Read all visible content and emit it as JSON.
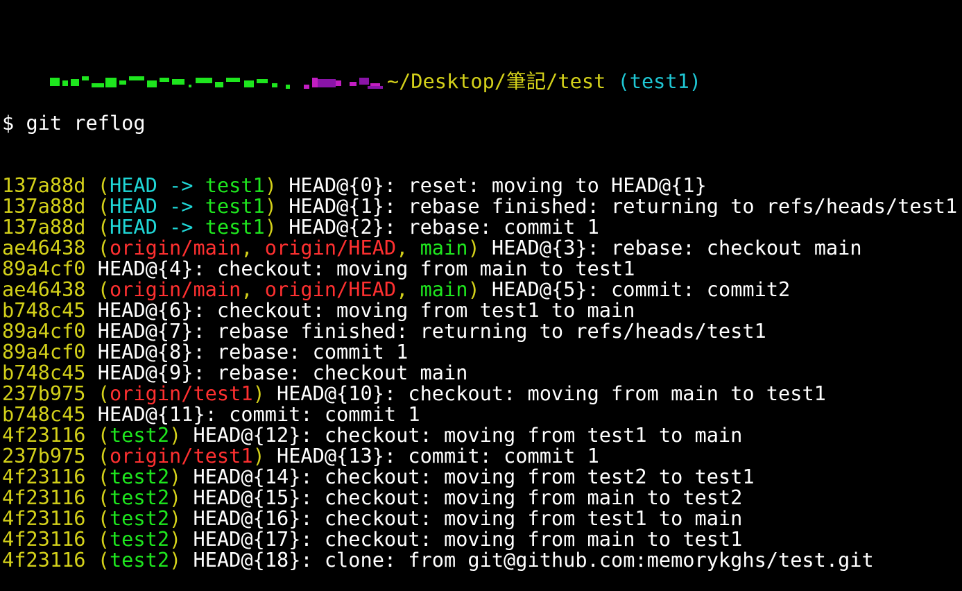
{
  "prompt": {
    "path": "~/Desktop/筆記/test",
    "branch": "(test1)"
  },
  "command": {
    "symbol": "$",
    "text": "git reflog"
  },
  "colors": {
    "hash": "#d4d11a",
    "head": "#1fd7d7",
    "local_branch": "#1ee61e",
    "remote_branch": "#ff3030",
    "text": "#ffffff",
    "background": "#000000"
  },
  "reflog": [
    {
      "hash": "137a88d",
      "refs": [
        {
          "t": "(",
          "c": "yellow"
        },
        {
          "t": "HEAD -> ",
          "c": "cyan"
        },
        {
          "t": "test1",
          "c": "green"
        },
        {
          "t": ")",
          "c": "yellow"
        }
      ],
      "message": "HEAD@{0}: reset: moving to HEAD@{1}"
    },
    {
      "hash": "137a88d",
      "refs": [
        {
          "t": "(",
          "c": "yellow"
        },
        {
          "t": "HEAD -> ",
          "c": "cyan"
        },
        {
          "t": "test1",
          "c": "green"
        },
        {
          "t": ")",
          "c": "yellow"
        }
      ],
      "message": "HEAD@{1}: rebase finished: returning to refs/heads/test1"
    },
    {
      "hash": "137a88d",
      "refs": [
        {
          "t": "(",
          "c": "yellow"
        },
        {
          "t": "HEAD -> ",
          "c": "cyan"
        },
        {
          "t": "test1",
          "c": "green"
        },
        {
          "t": ")",
          "c": "yellow"
        }
      ],
      "message": "HEAD@{2}: rebase: commit 1"
    },
    {
      "hash": "ae46438",
      "refs": [
        {
          "t": "(",
          "c": "yellow"
        },
        {
          "t": "origin/main",
          "c": "red"
        },
        {
          "t": ", ",
          "c": "yellow"
        },
        {
          "t": "origin/HEAD",
          "c": "red"
        },
        {
          "t": ", ",
          "c": "yellow"
        },
        {
          "t": "main",
          "c": "green"
        },
        {
          "t": ")",
          "c": "yellow"
        }
      ],
      "message": "HEAD@{3}: rebase: checkout main"
    },
    {
      "hash": "89a4cf0",
      "refs": [],
      "message": "HEAD@{4}: checkout: moving from main to test1"
    },
    {
      "hash": "ae46438",
      "refs": [
        {
          "t": "(",
          "c": "yellow"
        },
        {
          "t": "origin/main",
          "c": "red"
        },
        {
          "t": ", ",
          "c": "yellow"
        },
        {
          "t": "origin/HEAD",
          "c": "red"
        },
        {
          "t": ", ",
          "c": "yellow"
        },
        {
          "t": "main",
          "c": "green"
        },
        {
          "t": ")",
          "c": "yellow"
        }
      ],
      "message": "HEAD@{5}: commit: commit2"
    },
    {
      "hash": "b748c45",
      "refs": [],
      "message": "HEAD@{6}: checkout: moving from test1 to main"
    },
    {
      "hash": "89a4cf0",
      "refs": [],
      "message": "HEAD@{7}: rebase finished: returning to refs/heads/test1"
    },
    {
      "hash": "89a4cf0",
      "refs": [],
      "message": "HEAD@{8}: rebase: commit 1"
    },
    {
      "hash": "b748c45",
      "refs": [],
      "message": "HEAD@{9}: rebase: checkout main"
    },
    {
      "hash": "237b975",
      "refs": [
        {
          "t": "(",
          "c": "yellow"
        },
        {
          "t": "origin/test1",
          "c": "red"
        },
        {
          "t": ")",
          "c": "yellow"
        }
      ],
      "message": "HEAD@{10}: checkout: moving from main to test1"
    },
    {
      "hash": "b748c45",
      "refs": [],
      "message": "HEAD@{11}: commit: commit 1"
    },
    {
      "hash": "4f23116",
      "refs": [
        {
          "t": "(",
          "c": "yellow"
        },
        {
          "t": "test2",
          "c": "green"
        },
        {
          "t": ")",
          "c": "yellow"
        }
      ],
      "message": "HEAD@{12}: checkout: moving from test1 to main"
    },
    {
      "hash": "237b975",
      "refs": [
        {
          "t": "(",
          "c": "yellow"
        },
        {
          "t": "origin/test1",
          "c": "red"
        },
        {
          "t": ")",
          "c": "yellow"
        }
      ],
      "message": "HEAD@{13}: commit: commit 1"
    },
    {
      "hash": "4f23116",
      "refs": [
        {
          "t": "(",
          "c": "yellow"
        },
        {
          "t": "test2",
          "c": "green"
        },
        {
          "t": ")",
          "c": "yellow"
        }
      ],
      "message": "HEAD@{14}: checkout: moving from test2 to test1"
    },
    {
      "hash": "4f23116",
      "refs": [
        {
          "t": "(",
          "c": "yellow"
        },
        {
          "t": "test2",
          "c": "green"
        },
        {
          "t": ")",
          "c": "yellow"
        }
      ],
      "message": "HEAD@{15}: checkout: moving from main to test2"
    },
    {
      "hash": "4f23116",
      "refs": [
        {
          "t": "(",
          "c": "yellow"
        },
        {
          "t": "test2",
          "c": "green"
        },
        {
          "t": ")",
          "c": "yellow"
        }
      ],
      "message": "HEAD@{16}: checkout: moving from test1 to main"
    },
    {
      "hash": "4f23116",
      "refs": [
        {
          "t": "(",
          "c": "yellow"
        },
        {
          "t": "test2",
          "c": "green"
        },
        {
          "t": ")",
          "c": "yellow"
        }
      ],
      "message": "HEAD@{17}: checkout: moving from main to test1"
    },
    {
      "hash": "4f23116",
      "refs": [
        {
          "t": "(",
          "c": "yellow"
        },
        {
          "t": "test2",
          "c": "green"
        },
        {
          "t": ")",
          "c": "yellow"
        }
      ],
      "message": "HEAD@{18}: clone: from git@github.com:memorykghs/test.git"
    }
  ]
}
